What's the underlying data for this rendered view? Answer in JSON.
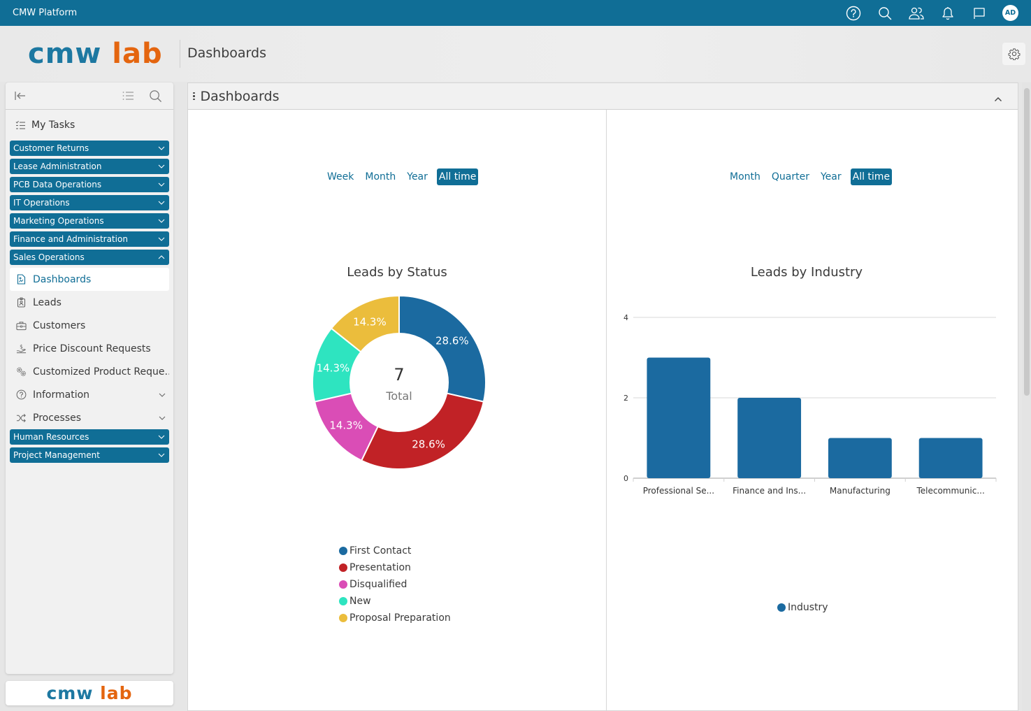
{
  "topbar": {
    "app_title": "CMW Platform",
    "icons": [
      "help-icon",
      "search-icon",
      "users-icon",
      "bell-icon",
      "flag-icon"
    ],
    "avatar_initials": "AD"
  },
  "header": {
    "logo_cmw": "cmw",
    "logo_lab": "lab",
    "page_title": "Dashboards",
    "settings_icon": "gear-icon"
  },
  "sidebar": {
    "top_icons": [
      "collapse-sidebar-icon",
      "list-icon",
      "search-icon"
    ],
    "my_tasks": "My Tasks",
    "groups_before": [
      {
        "label": "Customer Returns"
      },
      {
        "label": "Lease Administration"
      },
      {
        "label": "PCB Data Operations"
      },
      {
        "label": "IT Operations"
      },
      {
        "label": "Marketing Operations"
      },
      {
        "label": "Finance and Administration"
      }
    ],
    "expanded_group": {
      "label": "Sales Operations",
      "items": [
        {
          "label": "Dashboards",
          "icon": "dashboard-icon",
          "active": true
        },
        {
          "label": "Leads",
          "icon": "badge-icon"
        },
        {
          "label": "Customers",
          "icon": "briefcase-icon"
        },
        {
          "label": "Price Discount Requests",
          "icon": "hand-dollar-icon"
        },
        {
          "label": "Customized Product Reque...",
          "icon": "gears-icon"
        },
        {
          "label": "Information",
          "icon": "help-circle-icon",
          "expandable": true
        },
        {
          "label": "Processes",
          "icon": "shuffle-icon",
          "expandable": true
        }
      ]
    },
    "groups_after": [
      {
        "label": "Human Resources"
      },
      {
        "label": "Project Management"
      }
    ],
    "footer_logo_cmw": "cmw",
    "footer_logo_lab": "lab"
  },
  "panel": {
    "title": "Dashboards",
    "left_filters": [
      {
        "label": "Week"
      },
      {
        "label": "Month"
      },
      {
        "label": "Year"
      },
      {
        "label": "All time",
        "active": true
      }
    ],
    "right_filters": [
      {
        "label": "Month"
      },
      {
        "label": "Quarter"
      },
      {
        "label": "Year"
      },
      {
        "label": "All time",
        "active": true
      }
    ]
  },
  "chart_data": [
    {
      "type": "pie",
      "title": "Leads by Status",
      "center_value": "7",
      "center_label": "Total",
      "categories": [
        "First Contact",
        "Presentation",
        "Disqualified",
        "New",
        "Proposal Preparation"
      ],
      "values": [
        2,
        2,
        1,
        1,
        1
      ],
      "labels": [
        "28.6%",
        "28.6%",
        "14.3%",
        "14.3%",
        "14.3%"
      ],
      "colors": [
        "#1b6aa0",
        "#c12226",
        "#da4db6",
        "#2ee4c0",
        "#ebbd3c"
      ],
      "legend": "bottom"
    },
    {
      "type": "bar",
      "title": "Leads by Industry",
      "categories": [
        "Professional Se...",
        "Finance and Ins...",
        "Manufacturing",
        "Telecommunic..."
      ],
      "series": [
        {
          "name": "Industry",
          "values": [
            3,
            2,
            1,
            1
          ],
          "color": "#1b6aa0"
        }
      ],
      "yticks": [
        0,
        2,
        4
      ],
      "ylim": [
        0,
        4
      ],
      "xlabel": "",
      "ylabel": "",
      "grid": true,
      "legend": "bottom"
    }
  ]
}
